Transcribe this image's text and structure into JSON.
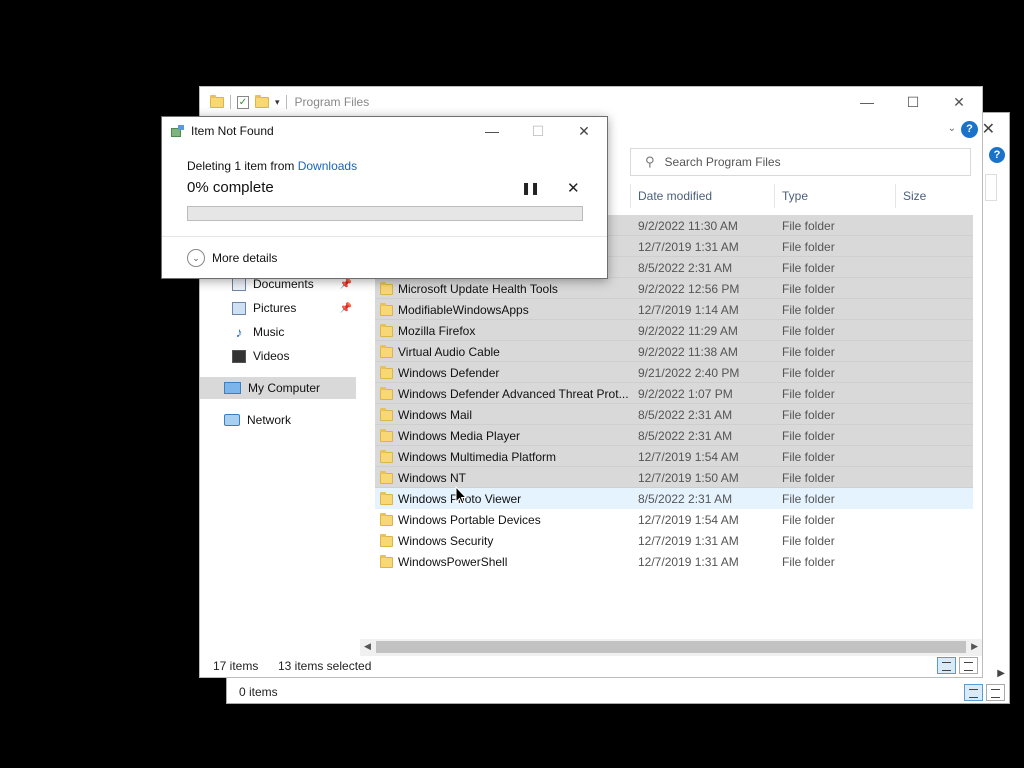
{
  "background_window": {
    "status_text": "0 items",
    "close_glyph": "✕",
    "help_glyph": "?",
    "scroll_right_glyph": "▶"
  },
  "main_window": {
    "title": "Program Files",
    "controls": {
      "minimize": "—",
      "maximize": "☐",
      "close": "✕"
    },
    "ribbon_chevron": "⌄",
    "help_glyph": "?",
    "dropdown_caret": "▾",
    "check_glyph": "✓"
  },
  "search": {
    "placeholder": "Search Program Files",
    "icon": "search-icon",
    "glyph": "⚲"
  },
  "columns": {
    "date": "Date modified",
    "type": "Type",
    "size": "Size"
  },
  "nav": {
    "items": [
      {
        "label": "Documents",
        "icon": "documents-icon",
        "pinned": true
      },
      {
        "label": "Pictures",
        "icon": "pictures-icon",
        "pinned": true
      },
      {
        "label": "Music",
        "icon": "music-icon",
        "pinned": false
      },
      {
        "label": "Videos",
        "icon": "videos-icon",
        "pinned": false
      },
      {
        "label": "My Computer",
        "icon": "computer-icon",
        "selected": true
      },
      {
        "label": "Network",
        "icon": "network-icon"
      }
    ],
    "pin_glyph": "📌",
    "music_glyph": "♪"
  },
  "files": [
    {
      "name": "",
      "date": "9/2/2022 11:30 AM",
      "type": "File folder",
      "selected": true
    },
    {
      "name": "",
      "date": "12/7/2019 1:31 AM",
      "type": "File folder",
      "selected": true
    },
    {
      "name": "",
      "date": "8/5/2022 2:31 AM",
      "type": "File folder",
      "selected": true
    },
    {
      "name": "Microsoft Update Health Tools",
      "date": "9/2/2022 12:56 PM",
      "type": "File folder",
      "selected": true
    },
    {
      "name": "ModifiableWindowsApps",
      "date": "12/7/2019 1:14 AM",
      "type": "File folder",
      "selected": true
    },
    {
      "name": "Mozilla Firefox",
      "date": "9/2/2022 11:29 AM",
      "type": "File folder",
      "selected": true
    },
    {
      "name": "Virtual Audio Cable",
      "date": "9/2/2022 11:38 AM",
      "type": "File folder",
      "selected": true
    },
    {
      "name": "Windows Defender",
      "date": "9/21/2022 2:40 PM",
      "type": "File folder",
      "selected": true
    },
    {
      "name": "Windows Defender Advanced Threat Prot...",
      "date": "9/2/2022 1:07 PM",
      "type": "File folder",
      "selected": true
    },
    {
      "name": "Windows Mail",
      "date": "8/5/2022 2:31 AM",
      "type": "File folder",
      "selected": true
    },
    {
      "name": "Windows Media Player",
      "date": "8/5/2022 2:31 AM",
      "type": "File folder",
      "selected": true
    },
    {
      "name": "Windows Multimedia Platform",
      "date": "12/7/2019 1:54 AM",
      "type": "File folder",
      "selected": true
    },
    {
      "name": "Windows NT",
      "date": "12/7/2019 1:50 AM",
      "type": "File folder",
      "selected": true
    },
    {
      "name": "Windows Photo Viewer",
      "date": "8/5/2022 2:31 AM",
      "type": "File folder",
      "selected": false,
      "hover": true
    },
    {
      "name": "Windows Portable Devices",
      "date": "12/7/2019 1:54 AM",
      "type": "File folder",
      "selected": false
    },
    {
      "name": "Windows Security",
      "date": "12/7/2019 1:31 AM",
      "type": "File folder",
      "selected": false
    },
    {
      "name": "WindowsPowerShell",
      "date": "12/7/2019 1:31 AM",
      "type": "File folder",
      "selected": false
    }
  ],
  "scrollbar": {
    "left_glyph": "◀",
    "right_glyph": "▶"
  },
  "status": {
    "item_count": "17 items",
    "selected_count": "13 items selected"
  },
  "dialog": {
    "title": "Item Not Found",
    "controls": {
      "minimize": "—",
      "maximize": "☐",
      "close": "✕"
    },
    "line_prefix": "Deleting 1 item from ",
    "line_link": "Downloads",
    "percent_text": "0% complete",
    "progress": 0,
    "pause_glyph": "❚❚",
    "cancel_glyph": "✕",
    "more_details": "More details",
    "more_details_glyph": "⌄"
  },
  "colors": {
    "accent": "#1a73c9",
    "selection": "#d9d9d9",
    "hover": "#e5f3ff",
    "folder": "#f8d775",
    "link": "#1a64b8"
  }
}
